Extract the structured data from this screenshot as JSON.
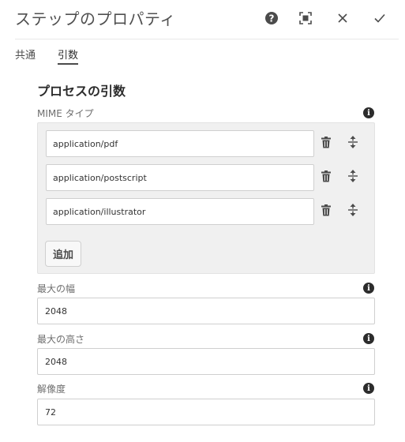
{
  "dialog": {
    "title": "ステップのプロパティ",
    "help_icon": "question-circle-icon",
    "fullscreen_icon": "fullscreen-icon",
    "close_icon": "close-icon",
    "done_icon": "checkmark-icon"
  },
  "tabs": [
    {
      "label": "共通",
      "active": false
    },
    {
      "label": "引数",
      "active": true
    }
  ],
  "section": {
    "title": "プロセスの引数"
  },
  "mime": {
    "label": "MIME タイプ",
    "items": [
      {
        "value": "application/pdf"
      },
      {
        "value": "application/postscript"
      },
      {
        "value": "application/illustrator"
      }
    ],
    "add_label": "追加",
    "delete_icon": "trash-icon",
    "reorder_icon": "drag-reorder-icon"
  },
  "fields": [
    {
      "label": "最大の幅",
      "value": "2048"
    },
    {
      "label": "最大の高さ",
      "value": "2048"
    },
    {
      "label": "解像度",
      "value": "72"
    }
  ],
  "info_icon": "info-icon",
  "colors": {
    "text": "#4b4b4b",
    "panel": "#f0f0f0",
    "border": "#cfcfcf"
  }
}
